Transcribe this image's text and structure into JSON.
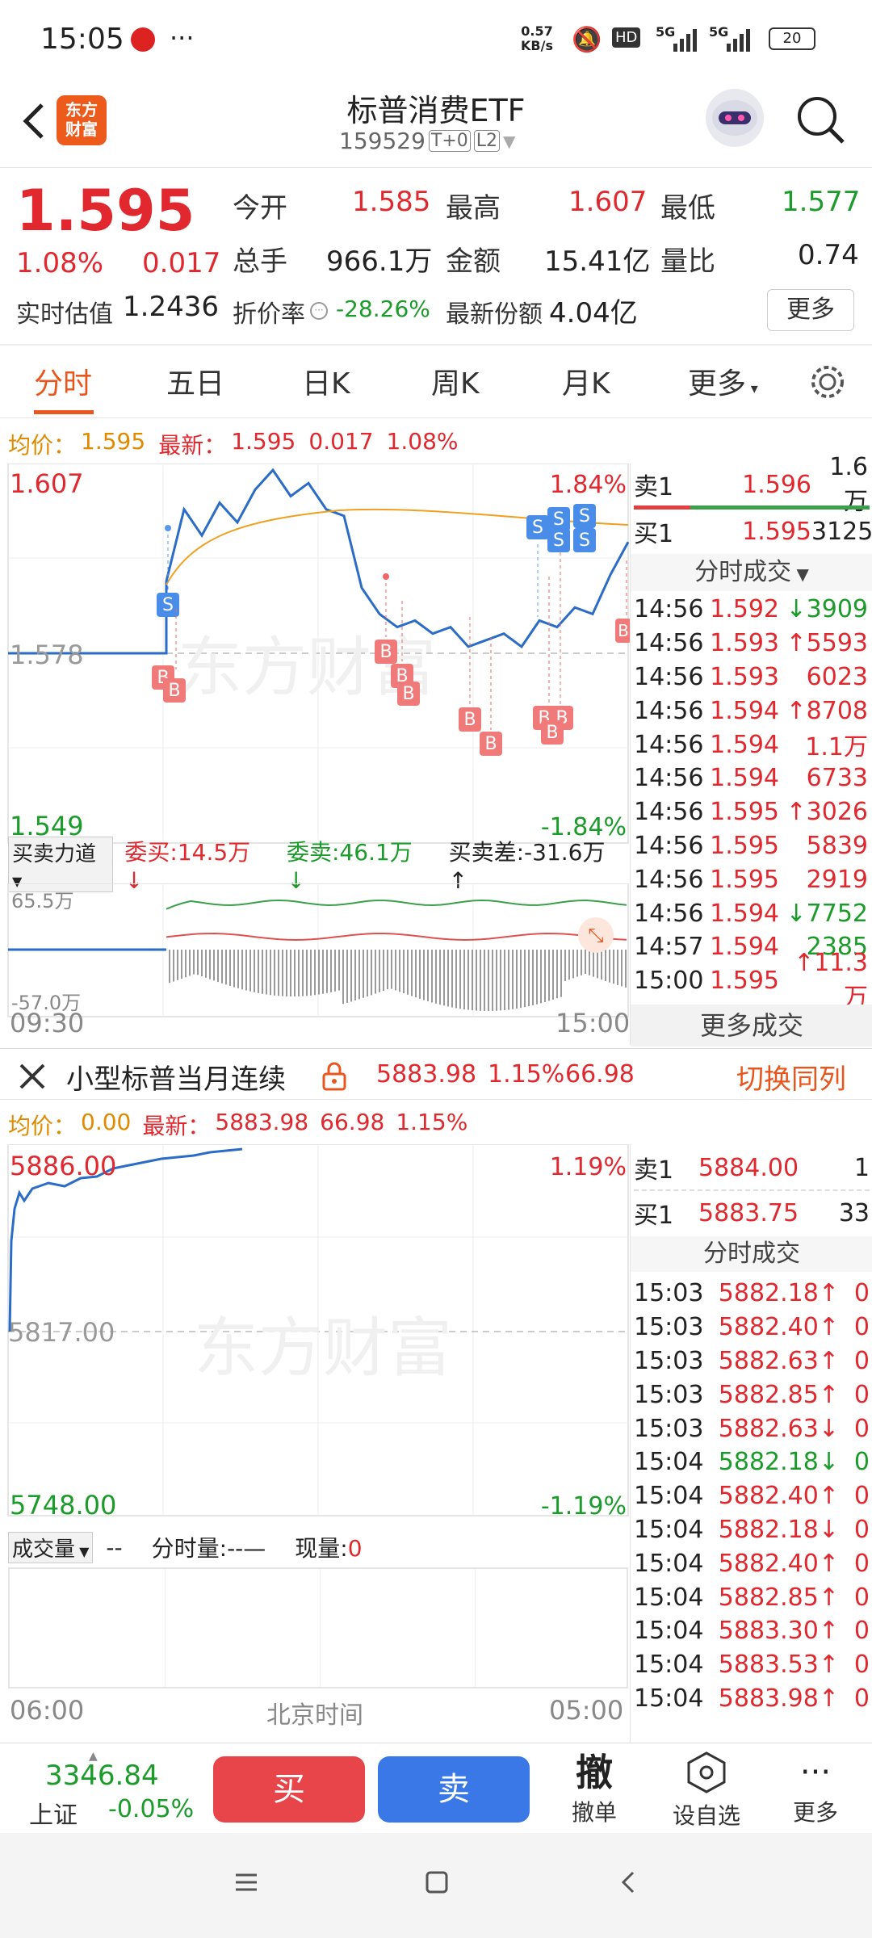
{
  "status_bar": {
    "time": "15:05",
    "speed_top": "0.57",
    "speed_bottom": "KB/s",
    "hd": "HD",
    "net1": "5G",
    "net2": "5G",
    "battery": "20"
  },
  "header": {
    "title": "标普消费ETF",
    "code": "159529",
    "badge1": "T+0",
    "badge2": "L2",
    "logo_line1": "东方",
    "logo_line2": "财富"
  },
  "quote": {
    "price": "1.595",
    "pct": "1.08%",
    "chg": "0.017",
    "open_label": "今开",
    "open": "1.585",
    "high_label": "最高",
    "high": "1.607",
    "low_label": "最低",
    "low": "1.577",
    "vol_label": "总手",
    "vol": "966.1万",
    "amt_label": "金额",
    "amt": "15.41亿",
    "ratio_label": "量比",
    "ratio": "0.74",
    "est_label": "实时估值",
    "est": "1.2436",
    "disc_label": "折价率",
    "disc": "-28.26%",
    "shares_label": "最新份额",
    "shares": "4.04亿",
    "more_btn": "更多"
  },
  "tabs": [
    "分时",
    "五日",
    "日K",
    "周K",
    "月K",
    "更多"
  ],
  "chart1": {
    "avg_label": "均价：",
    "avg": "1.595",
    "last_label": "最新：",
    "last": "1.595",
    "last_chg": "0.017",
    "last_pct": "1.08%",
    "y_high": "1.607",
    "y_mid": "1.578",
    "y_low": "1.549",
    "pct_high": "1.84%",
    "pct_low": "-1.84%",
    "t_start": "09:30",
    "t_end": "15:00",
    "force_btn": "买卖力道",
    "wei_buy": "委买:14.5万",
    "wei_sell": "委卖:46.1万",
    "diff": "买卖差:-31.6万",
    "sub_top": "65.5万",
    "sub_bottom": "-57.0万",
    "watermark": "东方财富"
  },
  "orderbook1": {
    "sell_label": "卖1",
    "sell_price": "1.596",
    "sell_vol": "1.6万",
    "buy_label": "买1",
    "buy_price": "1.595",
    "buy_vol": "3125",
    "trades_title": "分时成交",
    "trades": [
      {
        "t": "14:56",
        "p": "1.592",
        "v": "↓3909",
        "c": "green"
      },
      {
        "t": "14:56",
        "p": "1.593",
        "v": "↑5593",
        "c": "red"
      },
      {
        "t": "14:56",
        "p": "1.593",
        "v": "6023",
        "c": "red"
      },
      {
        "t": "14:56",
        "p": "1.594",
        "v": "↑8708",
        "c": "red"
      },
      {
        "t": "14:56",
        "p": "1.594",
        "v": "1.1万",
        "c": "red"
      },
      {
        "t": "14:56",
        "p": "1.594",
        "v": "6733",
        "c": "red"
      },
      {
        "t": "14:56",
        "p": "1.595",
        "v": "↑3026",
        "c": "red"
      },
      {
        "t": "14:56",
        "p": "1.595",
        "v": "5839",
        "c": "red"
      },
      {
        "t": "14:56",
        "p": "1.595",
        "v": "2919",
        "c": "red"
      },
      {
        "t": "14:56",
        "p": "1.594",
        "v": "↓7752",
        "c": "green"
      },
      {
        "t": "14:57",
        "p": "1.594",
        "v": "2385",
        "c": "green"
      },
      {
        "t": "15:00",
        "p": "1.595",
        "v": "↑11.3万",
        "c": "red"
      }
    ],
    "more_trades": "更多成交"
  },
  "futures": {
    "name": "小型标普当月连续",
    "price": "5883.98",
    "pct": "1.15%",
    "chg": "66.98",
    "switch": "切换同列",
    "avg_label": "均价：",
    "avg": "0.00",
    "last_label": "最新：",
    "last": "5883.98",
    "last_chg": "66.98",
    "last_pct": "1.15%",
    "y_high": "5886.00",
    "y_mid": "5817.00",
    "y_low": "5748.00",
    "pct_high": "1.19%",
    "pct_low": "-1.19%",
    "vol_btn": "成交量",
    "vol_val": "--",
    "fen_label": "分时量:",
    "fen_val": "--—",
    "now_label": "现量:",
    "now_val": "0",
    "t_start": "06:00",
    "t_mid": "北京时间",
    "t_end": "05:00",
    "watermark": "东方财富",
    "sell_label": "卖1",
    "sell_price": "5884.00",
    "sell_vol": "1",
    "buy_label": "买1",
    "buy_price": "5883.75",
    "buy_vol": "33",
    "trades_title": "分时成交",
    "trades": [
      {
        "t": "15:03",
        "p": "5882.18↑",
        "v": "0",
        "c": "red"
      },
      {
        "t": "15:03",
        "p": "5882.40↑",
        "v": "0",
        "c": "red"
      },
      {
        "t": "15:03",
        "p": "5882.63↑",
        "v": "0",
        "c": "red"
      },
      {
        "t": "15:03",
        "p": "5882.85↑",
        "v": "0",
        "c": "red"
      },
      {
        "t": "15:03",
        "p": "5882.63↓",
        "v": "0",
        "c": "red"
      },
      {
        "t": "15:04",
        "p": "5882.18↓",
        "v": "0",
        "c": "green"
      },
      {
        "t": "15:04",
        "p": "5882.40↑",
        "v": "0",
        "c": "red"
      },
      {
        "t": "15:04",
        "p": "5882.18↓",
        "v": "0",
        "c": "red"
      },
      {
        "t": "15:04",
        "p": "5882.40↑",
        "v": "0",
        "c": "red"
      },
      {
        "t": "15:04",
        "p": "5882.85↑",
        "v": "0",
        "c": "red"
      },
      {
        "t": "15:04",
        "p": "5883.30↑",
        "v": "0",
        "c": "red"
      },
      {
        "t": "15:04",
        "p": "5883.53↑",
        "v": "0",
        "c": "red"
      },
      {
        "t": "15:04",
        "p": "5883.98↑",
        "v": "0",
        "c": "red"
      }
    ]
  },
  "bottom": {
    "index_val": "3346.84",
    "index_name": "上证",
    "index_pct": "-0.05%",
    "buy": "买",
    "sell": "卖",
    "cancel_glyph": "撤",
    "cancel": "撤单",
    "watch": "设自选",
    "more": "更多"
  },
  "colors": {
    "up": "#e0282e",
    "down": "#1a9b2a",
    "accent": "#e8561e",
    "buy_btn": "#e8454a",
    "sell_btn": "#3a78e8",
    "line": "#2a6cc7",
    "avg_line": "#f0a020"
  },
  "chart_data": {
    "type": "line",
    "title": "",
    "series": [
      {
        "name": "",
        "values": [
          1.578,
          1.578,
          1.578,
          1.578,
          1.578,
          1.589,
          1.6,
          1.596,
          1.601,
          1.598,
          1.603,
          1.606,
          1.602,
          1.604,
          1.6,
          1.599,
          1.588,
          1.584,
          1.582,
          1.583,
          1.581,
          1.582,
          1.579,
          1.58,
          1.581,
          1.579,
          1.583,
          1.582,
          1.585,
          1.584,
          1.59,
          1.595
        ]
      }
    ],
    "ylim": [
      1.549,
      1.607
    ]
  }
}
